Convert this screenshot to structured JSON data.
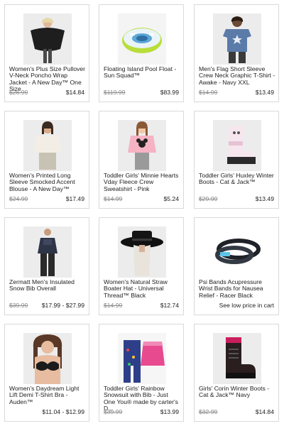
{
  "products": [
    {
      "title": "Women's Plus Size Pullover V-Neck Poncho Wrap Jacket - A New Day™ One Size",
      "was": "$26.99",
      "now": "$14.84",
      "image": "poncho-jacket-photo"
    },
    {
      "title": "Floating Island Pool Float - Sun Squad™",
      "was": "$119.99",
      "now": "$83.99",
      "image": "pool-float-photo"
    },
    {
      "title": "Men's Flag Short Sleeve Crew Neck Graphic T-Shirt - Awake - Navy XXL",
      "was": "$14.99",
      "now": "$13.49",
      "image": "mens-tshirt-photo"
    },
    {
      "title": "Women's Printed Long Sleeve Smocked Accent Blouse - A New Day™",
      "was": "$24.99",
      "now": "$17.49",
      "image": "womens-blouse-photo"
    },
    {
      "title": "Toddler Girls' Minnie Hearts Vday Fleece Crew Sweatshirt - Pink",
      "was": "$14.99",
      "now": "$5.24",
      "image": "minnie-sweatshirt-photo"
    },
    {
      "title": "Toddler Girls' Huxley Winter Boots - Cat & Jack™",
      "was": "$29.99",
      "now": "$13.49",
      "image": "winter-boots-photo"
    },
    {
      "title": "Zermatt Men's Insulated Snow Bib Overall",
      "was": "$39.99",
      "now": "$17.99 - $27.99",
      "image": "snow-bib-photo"
    },
    {
      "title": "Women's Natural Straw Boater Hat - Universal Thread™ Black",
      "was": "$14.99",
      "now": "$12.74",
      "image": "boater-hat-photo"
    },
    {
      "title": "Psi Bands Acupressure Wrist Bands for Nausea Relief - Racer Black",
      "was": "",
      "now": "See low price in cart",
      "image": "wrist-bands-photo"
    },
    {
      "title": "Women's Daydream Light Lift Demi T-Shirt Bra - Auden™",
      "was": "",
      "now": "$11.04 - $12.99",
      "image": "tshirt-bra-photo"
    },
    {
      "title": "Toddler Girls' Rainbow Snowsuit with Bib - Just One You® made by carter's D...",
      "was": "$39.99",
      "now": "$13.99",
      "image": "snowsuit-photo"
    },
    {
      "title": "Girls' Corin Winter Boots - Cat & Jack™ Navy",
      "was": "$32.99",
      "now": "$14.84",
      "image": "girls-boots-photo"
    }
  ]
}
